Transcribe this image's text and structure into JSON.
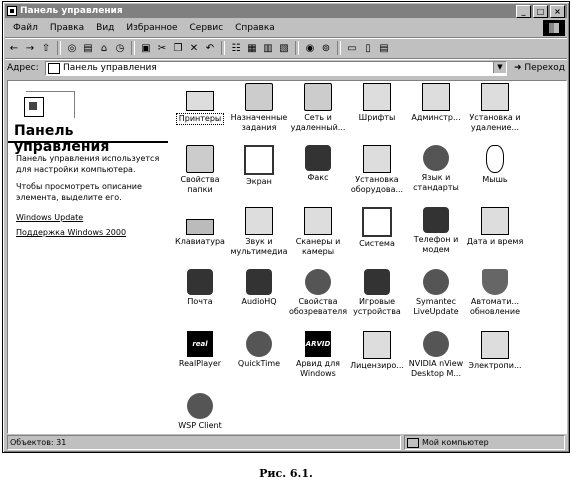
{
  "window": {
    "title": "Панель управления",
    "controls": [
      "_",
      "□",
      "×"
    ]
  },
  "menu": [
    "Файл",
    "Правка",
    "Вид",
    "Избранное",
    "Сервис",
    "Справка"
  ],
  "toolbar": {
    "icons": [
      "back-icon",
      "forward-icon",
      "up-folder-icon",
      "search-icon",
      "folders-icon",
      "home-icon",
      "history-icon",
      "move-icon",
      "cut-icon",
      "copy-icon",
      "delete-icon",
      "undo-icon",
      "view-icon"
    ]
  },
  "address": {
    "label": "Адрес:",
    "value": "Панель управления",
    "go": "Переход"
  },
  "left_panel": {
    "title": "Панель управления",
    "description": "Панель управления используется для настройки компьютера.",
    "hint": "Чтобы просмотреть описание элемента, выделите его.",
    "links": [
      "Windows Update",
      "Поддержка Windows 2000"
    ]
  },
  "items": [
    {
      "label": "Принтеры",
      "icon": "printer-icon"
    },
    {
      "label": "Назначенные задания",
      "icon": "scheduled-tasks-icon"
    },
    {
      "label": "Сеть и удаленный...",
      "icon": "network-icon"
    },
    {
      "label": "Шрифты",
      "icon": "fonts-icon"
    },
    {
      "label": "Админcтр...",
      "icon": "admin-tools-icon"
    },
    {
      "label": "Установка и удаление...",
      "icon": "add-remove-icon"
    },
    {
      "label": "Свойства папки",
      "icon": "folder-options-icon"
    },
    {
      "label": "Экран",
      "icon": "display-icon"
    },
    {
      "label": "Факс",
      "icon": "fax-icon"
    },
    {
      "label": "Установка оборудова...",
      "icon": "hardware-icon"
    },
    {
      "label": "Язык и стандарты",
      "icon": "globe-icon"
    },
    {
      "label": "Мышь",
      "icon": "mouse-icon"
    },
    {
      "label": "Клавиатура",
      "icon": "keyboard-icon"
    },
    {
      "label": "Звук и мультимедиа",
      "icon": "sound-icon"
    },
    {
      "label": "Сканеры и камеры",
      "icon": "scanner-icon"
    },
    {
      "label": "Система",
      "icon": "system-icon"
    },
    {
      "label": "Телефон и модем",
      "icon": "phone-icon"
    },
    {
      "label": "Дата и время",
      "icon": "clock-icon"
    },
    {
      "label": "Почта",
      "icon": "mail-icon"
    },
    {
      "label": "AudioHQ",
      "icon": "audio-icon"
    },
    {
      "label": "Свойства обозревателя",
      "icon": "internet-icon"
    },
    {
      "label": "Игровые устройства",
      "icon": "joystick-icon"
    },
    {
      "label": "Symantec LiveUpdate",
      "icon": "liveupdate-icon"
    },
    {
      "label": "Автомати... обновление",
      "icon": "auto-update-icon"
    },
    {
      "label": "RealPlayer",
      "icon": "realplayer-icon",
      "badge": "real"
    },
    {
      "label": "QuickTime",
      "icon": "quicktime-icon"
    },
    {
      "label": "Арвид для Windows",
      "icon": "arvid-icon",
      "badge": "ARVID"
    },
    {
      "label": "Лицензиро...",
      "icon": "licensing-icon"
    },
    {
      "label": "NVIDIA nView Desktop M...",
      "icon": "nvidia-icon"
    },
    {
      "label": "Электропи...",
      "icon": "power-icon"
    },
    {
      "label": "WSP Client",
      "icon": "wsp-icon"
    }
  ],
  "status": {
    "left": "Объектов: 31",
    "right": "Мой компьютер"
  },
  "caption": "Рис. 6.1."
}
